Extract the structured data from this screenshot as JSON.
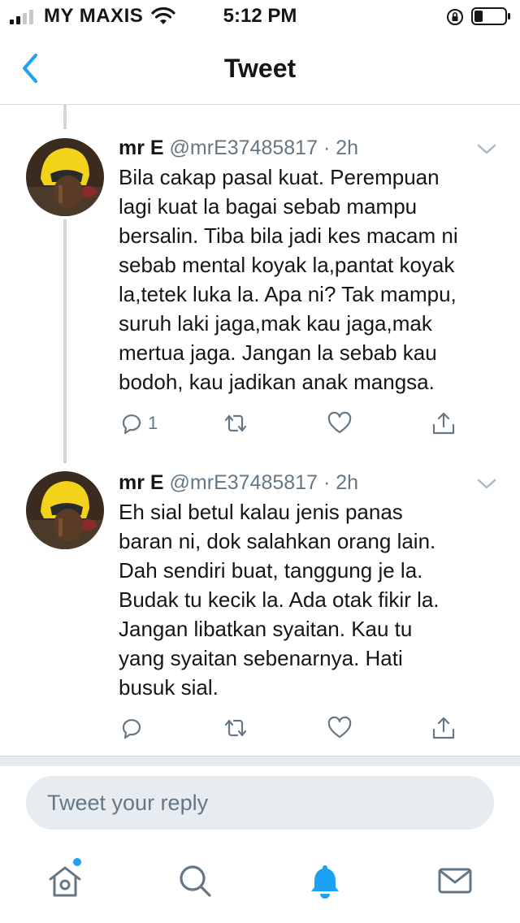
{
  "status_bar": {
    "carrier": "MY MAXIS",
    "time": "5:12 PM"
  },
  "nav": {
    "title": "Tweet"
  },
  "tweets": [
    {
      "name": "mr E",
      "handle": "@mrE37485817",
      "separator": "·",
      "time": "2h",
      "lines": [
        "Bila cakap pasal kuat. Perempuan",
        "lagi kuat la bagai sebab mampu",
        "bersalin. Tiba bila jadi kes macam ni",
        "sebab mental koyak la,pantat koyak",
        "la,tetek luka la. Apa ni? Tak mampu,",
        "suruh laki jaga,mak kau jaga,mak",
        "mertua jaga. Jangan la sebab kau",
        "bodoh, kau jadikan anak mangsa."
      ],
      "reply_count": "1"
    },
    {
      "name": "mr E",
      "handle": "@mrE37485817",
      "separator": "·",
      "time": "2h",
      "lines": [
        "Eh sial betul kalau jenis panas",
        "baran ni, dok salahkan orang lain.",
        "Dah sendiri buat, tanggung je la.",
        "Budak tu kecik la. Ada otak fikir la.",
        "Jangan libatkan syaitan. Kau tu",
        "yang syaitan sebenarnya. Hati",
        "busuk sial."
      ],
      "reply_count": ""
    }
  ],
  "reply_box": {
    "placeholder": "Tweet your reply"
  },
  "tab_bar": {
    "items": [
      "home-icon",
      "search-icon",
      "notifications-icon",
      "messages-icon"
    ],
    "active": "notifications-icon"
  },
  "colors": {
    "accent": "#1da1f2",
    "text": "#14171a",
    "muted": "#657786",
    "icon_gray": "#657786",
    "divider": "#e6ecf0"
  }
}
